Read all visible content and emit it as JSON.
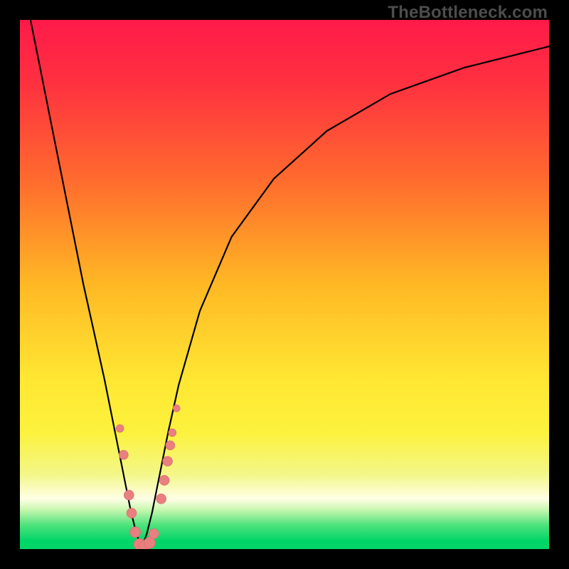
{
  "watermark": "TheBottleneck.com",
  "colors": {
    "gradient_stops": [
      {
        "offset": 0.0,
        "color": "#ff1a49"
      },
      {
        "offset": 0.12,
        "color": "#ff3140"
      },
      {
        "offset": 0.3,
        "color": "#ff6a2e"
      },
      {
        "offset": 0.5,
        "color": "#ffb824"
      },
      {
        "offset": 0.68,
        "color": "#ffe733"
      },
      {
        "offset": 0.78,
        "color": "#fcf23d"
      },
      {
        "offset": 0.86,
        "color": "#f3f78a"
      },
      {
        "offset": 0.905,
        "color": "#ffffe6"
      },
      {
        "offset": 0.925,
        "color": "#c9f7b0"
      },
      {
        "offset": 0.955,
        "color": "#4de27c"
      },
      {
        "offset": 0.985,
        "color": "#00d568"
      },
      {
        "offset": 1.0,
        "color": "#00d568"
      }
    ],
    "curve": "#000000",
    "marker_fill": "#e97f7f",
    "marker_stroke": "#d96a6a"
  },
  "chart_data": {
    "type": "line",
    "title": "",
    "xlabel": "",
    "ylabel": "",
    "xlim": [
      0,
      100
    ],
    "ylim": [
      0,
      100
    ],
    "x_min_point": 23,
    "series": [
      {
        "name": "bottleneck-curve",
        "x": [
          2,
          4,
          6,
          8,
          10,
          12,
          14,
          16,
          18,
          19,
          20,
          21,
          22,
          23,
          24,
          25,
          26,
          27,
          28,
          30,
          34,
          40,
          48,
          58,
          70,
          84,
          100
        ],
        "y": [
          100,
          90,
          80,
          70,
          60,
          50,
          41,
          32,
          22,
          17,
          12,
          7,
          3,
          0,
          3,
          7,
          12,
          17,
          22,
          31,
          45,
          59,
          70,
          79,
          86,
          91,
          95
        ]
      }
    ],
    "markers": {
      "name": "highlighted-points",
      "points": [
        {
          "x": 18.9,
          "y": 22.8,
          "r": 5.5
        },
        {
          "x": 19.6,
          "y": 17.8,
          "r": 6.5
        },
        {
          "x": 20.6,
          "y": 10.2,
          "r": 7.0
        },
        {
          "x": 21.1,
          "y": 6.8,
          "r": 7.0
        },
        {
          "x": 21.8,
          "y": 3.2,
          "r": 7.5
        },
        {
          "x": 22.6,
          "y": 0.9,
          "r": 8.0
        },
        {
          "x": 23.6,
          "y": 0.6,
          "r": 8.0
        },
        {
          "x": 24.5,
          "y": 1.2,
          "r": 8.0
        },
        {
          "x": 25.3,
          "y": 2.9,
          "r": 7.0
        },
        {
          "x": 26.7,
          "y": 9.5,
          "r": 7.0
        },
        {
          "x": 27.3,
          "y": 13.0,
          "r": 7.0
        },
        {
          "x": 27.9,
          "y": 16.6,
          "r": 7.0
        },
        {
          "x": 28.4,
          "y": 19.6,
          "r": 6.5
        },
        {
          "x": 28.8,
          "y": 22.0,
          "r": 5.5
        },
        {
          "x": 29.6,
          "y": 26.6,
          "r": 5.0
        }
      ]
    }
  }
}
